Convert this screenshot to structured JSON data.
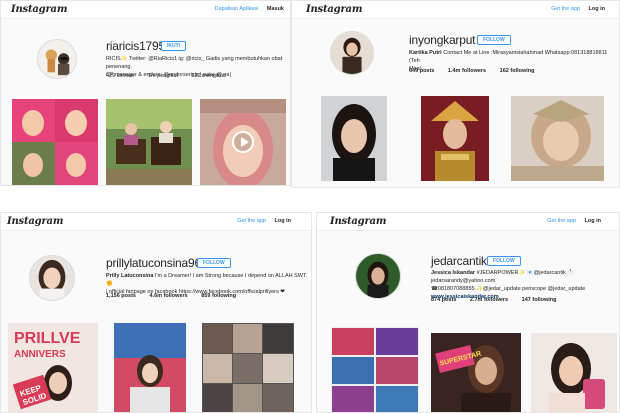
{
  "panel1": {
    "logo": "Instagram",
    "nav_app": "Dapatkan Aplikasi",
    "nav_login": "Masuk",
    "username": "riaricis1795",
    "follow": "IKUTI",
    "bio_line1": "RICIS✨ Twitter: @RiaRicis1 ig: @ricis_ Gadis yang membutuhkan obat penenang.",
    "bio_line2": "CP manager & endors: @endorsericis | pake @ ya|",
    "posts": "429 kiriman",
    "followers": "1m pengikut",
    "following": "322 mengikuti"
  },
  "panel2": {
    "logo": "Instagram",
    "nav_app": "Get the app",
    "nav_login": "Log in",
    "username": "inyongkarput",
    "follow": "FOLLOW",
    "bio_name": "Kartika Putri",
    "bio_line1": " Contact Me at Line :Mirasyamsiahahmad Whatsapp:081318818811 (Teh",
    "bio_line2": "Mira)",
    "posts": "649 posts",
    "followers": "1.4m followers",
    "following": "162 following"
  },
  "panel3": {
    "logo": "Instagram",
    "nav_app": "Get the app",
    "nav_login": "Log in",
    "username": "prillylatuconsina96",
    "follow": "FOLLOW",
    "bio_name": "Prilly Latuconsina",
    "bio_line1": " I'm a Dreamer! I am Strong because I depend on ALLAH SWT.✊",
    "bio_line2": "| official fanpage on facebook https://www.facebook.com/officialprillyers ❤",
    "posts": "1,156 posts",
    "followers": "4.6m followers",
    "following": "859 following",
    "thumb_text1": "PRILLVE",
    "thumb_text2": "ANNIVERS",
    "thumb_text3": "KEEP",
    "thumb_text4": "SOLID"
  },
  "panel4": {
    "logo": "Instagram",
    "nav_app": "Get the app",
    "nav_login": "Log in",
    "username": "jedarcantik",
    "follow": "FOLLOW",
    "bio_name": "Jessica Iskandar",
    "bio_line1": " #JEDARPOWER✨ 📧@jedarcantik 📩 jedarsarandy@yahoo.com",
    "bio_line2": "☎081807088855 ✨@jedar_update periscope @jedar_update",
    "bio_link": "www.jessicaiskandar.com",
    "posts": "874 posts",
    "followers": "2.7m followers",
    "following": "147 following",
    "thumb_text1": "SUPERSTAR"
  },
  "colors": {
    "link_blue": "#3897f0",
    "text": "#262626",
    "panel_bg": "#fafafa"
  },
  "icons": [
    "play-icon"
  ]
}
